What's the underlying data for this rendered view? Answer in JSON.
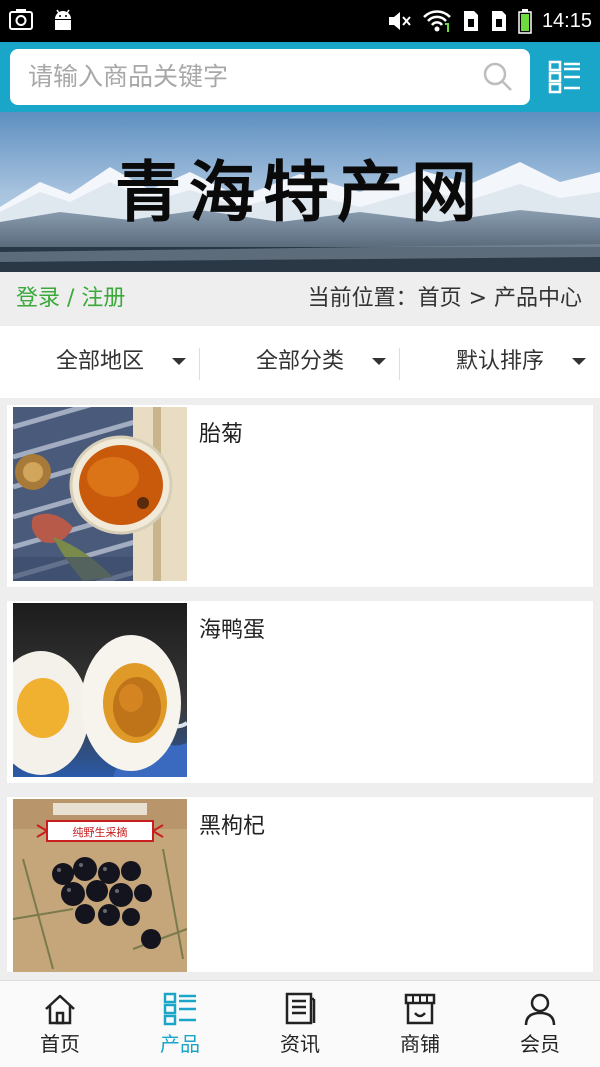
{
  "status_bar": {
    "time": "14:15",
    "left_icons": [
      "screenshot-icon",
      "android-icon"
    ],
    "right_icons": [
      "mute-icon",
      "wifi-icon",
      "sim1-icon",
      "sim2-icon",
      "battery-icon"
    ]
  },
  "search": {
    "placeholder": "请输入商品关键字"
  },
  "banner": {
    "title": "青海特产网"
  },
  "location_bar": {
    "login_label": "登录 / 注册",
    "breadcrumb": "当前位置：首页 > 产品中心"
  },
  "filters": [
    {
      "label": "全部地区"
    },
    {
      "label": "全部分类"
    },
    {
      "label": "默认排序"
    }
  ],
  "products": [
    {
      "name": "胎菊"
    },
    {
      "name": "海鸭蛋"
    },
    {
      "name": "黑枸杞",
      "image_caption": "纯野生采摘"
    }
  ],
  "bottom_nav": [
    {
      "label": "首页",
      "icon": "home-icon",
      "active": false
    },
    {
      "label": "产品",
      "icon": "product-list-icon",
      "active": true
    },
    {
      "label": "资讯",
      "icon": "news-icon",
      "active": false
    },
    {
      "label": "商铺",
      "icon": "shop-icon",
      "active": false
    },
    {
      "label": "会员",
      "icon": "member-icon",
      "active": false
    }
  ],
  "colors": {
    "accent": "#1aa6c9",
    "login_green": "#3aa93a",
    "background": "#eeeeee"
  }
}
